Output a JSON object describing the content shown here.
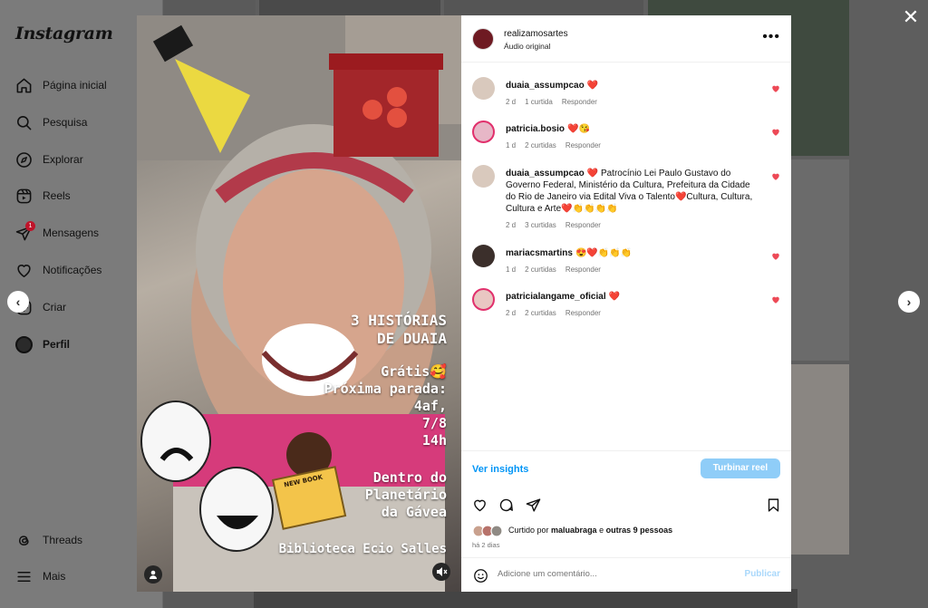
{
  "app": {
    "logo": "Instagram"
  },
  "sidebar": {
    "items": [
      {
        "label": "Página inicial",
        "icon": "home-icon"
      },
      {
        "label": "Pesquisa",
        "icon": "search-icon"
      },
      {
        "label": "Explorar",
        "icon": "compass-icon"
      },
      {
        "label": "Reels",
        "icon": "reels-icon"
      },
      {
        "label": "Mensagens",
        "icon": "messenger-icon",
        "badge": "1"
      },
      {
        "label": "Notificações",
        "icon": "heart-icon"
      },
      {
        "label": "Criar",
        "icon": "plus-square-icon"
      },
      {
        "label": "Perfil",
        "icon": "avatar-icon"
      }
    ],
    "bottom": [
      {
        "label": "Threads",
        "icon": "threads-icon"
      },
      {
        "label": "Mais",
        "icon": "menu-icon"
      }
    ]
  },
  "media": {
    "title_lines": [
      "3 HISTÓRIAS",
      "DE DUAIA"
    ],
    "info_lines": [
      "Grátis🥰",
      "Próxima parada:",
      "4af,",
      "7/8",
      "14h"
    ],
    "place_lines": [
      "Dentro do",
      "Planetário",
      "da Gávea"
    ],
    "library": "Biblioteca Ecio Salles",
    "book_text": "NEW BOOK"
  },
  "post": {
    "username": "realizamosartes",
    "audio": "Áudio original",
    "comments": [
      {
        "user": "duaia_assumpcao",
        "text": "❤️",
        "age": "2 d",
        "likes": "1 curtida",
        "reply": "Responder"
      },
      {
        "user": "patricia.bosio",
        "text": "❤️😘",
        "age": "1 d",
        "likes": "2 curtidas",
        "reply": "Responder"
      },
      {
        "user": "duaia_assumpcao",
        "text": "❤️ Patrocínio Lei Paulo Gustavo do Governo Federal, Ministério da Cultura, Prefeitura da Cidade do Rio de Janeiro via Edital Viva o Talento❤️Cultura, Cultura, Cultura e Arte❤️👏👏👏👏",
        "age": "2 d",
        "likes": "3 curtidas",
        "reply": "Responder"
      },
      {
        "user": "mariacsmartins",
        "text": "😍❤️👏👏👏",
        "age": "1 d",
        "likes": "2 curtidas",
        "reply": "Responder"
      },
      {
        "user": "patricialangame_oficial",
        "text": "❤️",
        "age": "2 d",
        "likes": "2 curtidas",
        "reply": "Responder"
      }
    ],
    "insights": "Ver insights",
    "boost": "Turbinar reel",
    "liked_by_prefix": "Curtido por",
    "liked_by_user": "maluabraga",
    "liked_by_and": "e",
    "liked_by_others": "outras 9 pessoas",
    "time": "há 2 dias",
    "comment_placeholder": "Adicione um comentário...",
    "publish": "Publicar"
  },
  "colors": {
    "accent": "#0095f6",
    "heart": "#ed4956",
    "story_ring": "#e1306c"
  }
}
